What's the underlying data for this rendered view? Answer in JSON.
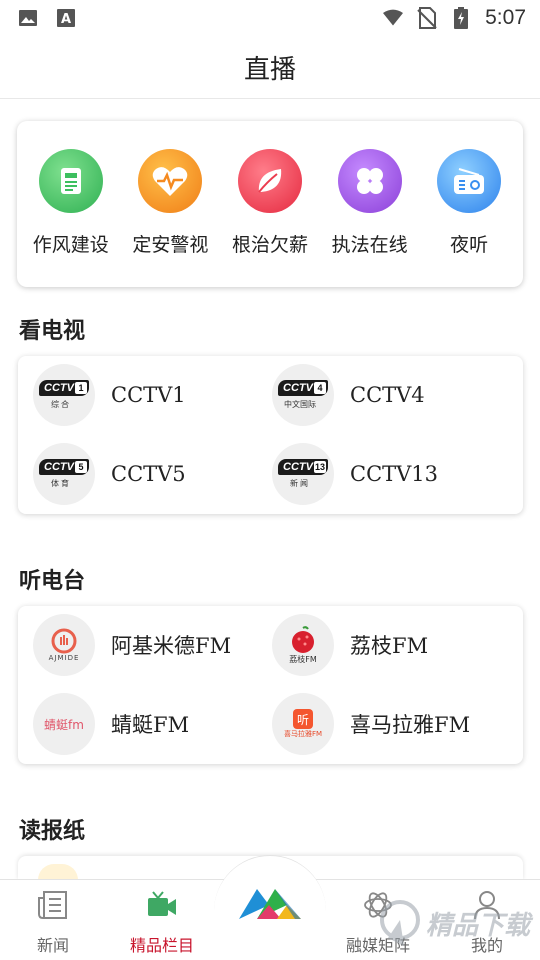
{
  "status_bar": {
    "time": "5:07"
  },
  "header": {
    "title": "直播"
  },
  "quick_links": [
    {
      "label": "作风建设",
      "icon": "document-icon",
      "color": "#3dbf5f"
    },
    {
      "label": "定安警视",
      "icon": "heartbeat-icon",
      "color": "#f58a1f"
    },
    {
      "label": "根治欠薪",
      "icon": "leaf-icon",
      "color": "#ec3c4f"
    },
    {
      "label": "执法在线",
      "icon": "clover-icon",
      "color": "#9a52e0"
    },
    {
      "label": "夜听",
      "icon": "radio-icon",
      "color": "#3a8ff0"
    }
  ],
  "tv_section": {
    "title": "看电视",
    "items": [
      {
        "label": "CCTV1",
        "num": "1",
        "sub": "综合"
      },
      {
        "label": "CCTV4",
        "num": "4",
        "sub": "中文国际"
      },
      {
        "label": "CCTV5",
        "num": "5",
        "sub": "体育"
      },
      {
        "label": "CCTV13",
        "num": "13",
        "sub": "新闻"
      }
    ]
  },
  "radio_section": {
    "title": "听电台",
    "items": [
      {
        "label": "阿基米德FM",
        "logo_text": "AJMIDE"
      },
      {
        "label": "荔枝FM",
        "logo_text": "荔枝FM"
      },
      {
        "label": "蜻蜓FM",
        "logo_text": "蜻蜓fm"
      },
      {
        "label": "喜马拉雅FM",
        "logo_text": "喜马拉雅FM"
      }
    ]
  },
  "newspaper_section": {
    "title": "读报纸"
  },
  "bottom_nav": {
    "items": [
      {
        "label": "新闻",
        "icon": "news-icon",
        "active": false
      },
      {
        "label": "精品栏目",
        "icon": "video-icon",
        "active": true
      },
      {
        "label": "融媒矩阵",
        "icon": "atom-icon",
        "active": false
      },
      {
        "label": "我的",
        "icon": "user-icon",
        "active": false
      }
    ]
  },
  "watermark": {
    "text": "精品下载"
  },
  "colors": {
    "active": "#c8152d",
    "accent_green": "#2f9e58"
  }
}
